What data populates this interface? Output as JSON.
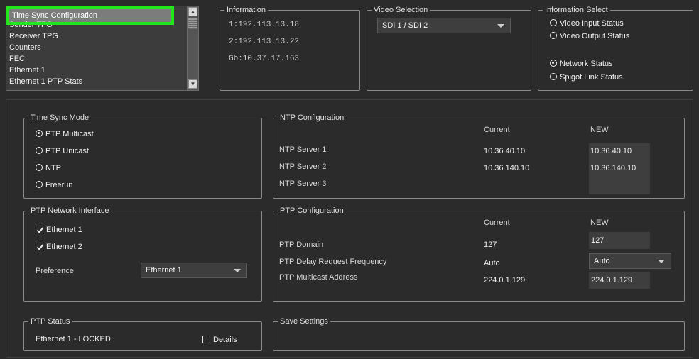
{
  "nav": {
    "items": [
      {
        "label": "Time Sync Configuration"
      },
      {
        "label": "Sender TPG"
      },
      {
        "label": "Receiver TPG"
      },
      {
        "label": "Counters"
      },
      {
        "label": "FEC"
      },
      {
        "label": "Ethernet 1"
      },
      {
        "label": "Ethernet 1 PTP Stats"
      }
    ]
  },
  "information": {
    "title": "Information",
    "lines": [
      "1:192.113.13.18",
      "2:192.113.13.22",
      "Gb:10.37.17.163"
    ]
  },
  "video_selection": {
    "title": "Video Selection",
    "selected": "SDI 1 / SDI 2"
  },
  "info_select": {
    "title": "Information Select",
    "options": [
      {
        "label": "Video Input Status",
        "checked": false
      },
      {
        "label": "Video Output Status",
        "checked": false
      },
      {
        "label": "Network Status",
        "checked": true
      },
      {
        "label": "Spigot Link Status",
        "checked": false
      }
    ]
  },
  "time_sync_mode": {
    "title": "Time Sync Mode",
    "options": [
      {
        "label": "PTP Multicast",
        "checked": true
      },
      {
        "label": "PTP Unicast",
        "checked": false
      },
      {
        "label": "NTP",
        "checked": false
      },
      {
        "label": "Freerun",
        "checked": false
      }
    ]
  },
  "ntp": {
    "title": "NTP Configuration",
    "col_current": "Current",
    "col_new": "NEW",
    "rows": [
      {
        "label": "NTP Server 1",
        "current": "10.36.40.10",
        "new": "10.36.40.10"
      },
      {
        "label": "NTP Server 2",
        "current": "10.36.140.10",
        "new": "10.36.140.10"
      },
      {
        "label": "NTP Server 3",
        "current": "",
        "new": ""
      }
    ]
  },
  "ptp_net": {
    "title": "PTP Network Interface",
    "eth1": "Ethernet 1",
    "eth2": "Ethernet 2",
    "eth1_checked": true,
    "eth2_checked": true,
    "preference_label": "Preference",
    "preference_value": "Ethernet 1"
  },
  "ptp_conf": {
    "title": "PTP Configuration",
    "col_current": "Current",
    "col_new": "NEW",
    "domain_label": "PTP Domain",
    "domain_current": "127",
    "domain_new": "127",
    "delay_label": "PTP Delay Request Frequency",
    "delay_current": "Auto",
    "delay_new": "Auto",
    "mcast_label": "PTP Multicast Address",
    "mcast_current": "224.0.1.129",
    "mcast_new": "224.0.1.129"
  },
  "ptp_status": {
    "title": "PTP Status",
    "status": "Ethernet 1  - LOCKED",
    "details_label": "Details",
    "details_checked": false
  },
  "save": {
    "title": "Save Settings"
  },
  "colors": {
    "background": "#2b2b2b",
    "highlight": "#22e51a",
    "field": "#3e3e3e"
  }
}
